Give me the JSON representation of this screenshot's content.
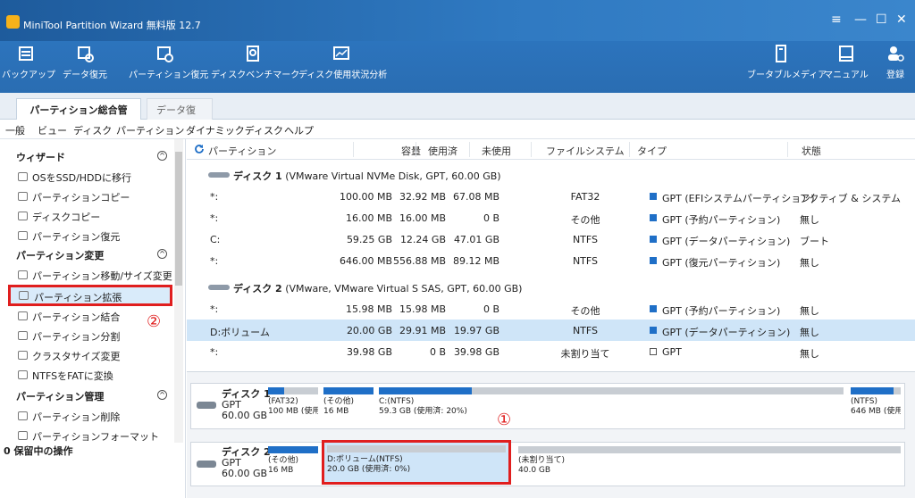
{
  "window": {
    "title": "MiniTool Partition Wizard 無料版 12.7",
    "controls": [
      "≡",
      "—",
      "☐",
      "✕"
    ]
  },
  "toolbar": {
    "items": [
      {
        "label": "バックアップ"
      },
      {
        "label": "データ復元"
      },
      {
        "label": "パーティション復元"
      },
      {
        "label": "ディスクベンチマーク"
      },
      {
        "label": "ディスク使用状況分析"
      }
    ],
    "right": [
      {
        "label": "ブータブルメディア"
      },
      {
        "label": "マニュアル"
      },
      {
        "label": "登録"
      }
    ]
  },
  "tabs": {
    "active": "パーティション総合管理",
    "inactive": "データ復元",
    "close": "✕"
  },
  "menu": [
    "一般",
    "ビュー",
    "ディスク",
    "パーティション",
    "ダイナミックディスク",
    "ヘルプ"
  ],
  "sidebar": {
    "wizard_title": "ウィザード",
    "wizard_items": [
      "OSをSSD/HDDに移行",
      "パーティションコピー",
      "ディスクコピー",
      "パーティション復元"
    ],
    "change_title": "パーティション変更",
    "change_items": [
      "パーティション移動/サイズ変更",
      "パーティション拡張",
      "パーティション結合",
      "パーティション分割",
      "クラスタサイズ変更",
      "NTFSをFATに変換"
    ],
    "manage_title": "パーティション管理",
    "manage_items": [
      "パーティション削除",
      "パーティションフォーマット"
    ],
    "pending": "0 保留中の操作",
    "marker2": "②"
  },
  "columns": [
    "パーティション",
    "容量",
    "使用済",
    "未使用",
    "ファイルシステム",
    "タイプ",
    "状態"
  ],
  "disks": [
    {
      "name": "ディスク 1",
      "detail": "(VMware Virtual NVMe Disk, GPT, 60.00 GB)",
      "rows": [
        {
          "p": "*:",
          "cap": "100.00 MB",
          "used": "32.92 MB",
          "free": "67.08 MB",
          "fs": "FAT32",
          "type": "GPT (EFIシステムパーティション)",
          "status": "アクティブ & システム"
        },
        {
          "p": "*:",
          "cap": "16.00 MB",
          "used": "16.00 MB",
          "free": "0 B",
          "fs": "その他",
          "type": "GPT (予約パーティション)",
          "status": "無し"
        },
        {
          "p": "C:",
          "cap": "59.25 GB",
          "used": "12.24 GB",
          "free": "47.01 GB",
          "fs": "NTFS",
          "type": "GPT (データパーティション)",
          "status": "ブート"
        },
        {
          "p": "*:",
          "cap": "646.00 MB",
          "used": "556.88 MB",
          "free": "89.12 MB",
          "fs": "NTFS",
          "type": "GPT (復元パーティション)",
          "status": "無し"
        }
      ]
    },
    {
      "name": "ディスク 2",
      "detail": "(VMware, VMware Virtual S SAS, GPT, 60.00 GB)",
      "rows": [
        {
          "p": "*:",
          "cap": "15.98 MB",
          "used": "15.98 MB",
          "free": "0 B",
          "fs": "その他",
          "type": "GPT (予約パーティション)",
          "status": "無し"
        },
        {
          "p": "D:ボリューム",
          "cap": "20.00 GB",
          "used": "29.91 MB",
          "free": "19.97 GB",
          "fs": "NTFS",
          "type": "GPT (データパーティション)",
          "status": "無し"
        },
        {
          "p": "*:",
          "cap": "39.98 GB",
          "used": "0 B",
          "free": "39.98 GB",
          "fs": "未割り当て",
          "type": "GPT",
          "status": "無し"
        }
      ]
    }
  ],
  "map": {
    "disk1": {
      "name": "ディスク 1",
      "type": "GPT",
      "size": "60.00 GB",
      "parts": [
        {
          "l1": "(FAT32)",
          "l2": "100 MB (使用",
          "used": 0.33
        },
        {
          "l1": "(その他)",
          "l2": "16 MB",
          "used": 1.0
        },
        {
          "l1": "C:(NTFS)",
          "l2": "59.3 GB (使用済: 20%)",
          "used": 0.2
        },
        {
          "l1": "(NTFS)",
          "l2": "646 MB (使用",
          "used": 0.86
        }
      ]
    },
    "disk2": {
      "name": "ディスク 2",
      "type": "GPT",
      "size": "60.00 GB",
      "parts": [
        {
          "l1": "(その他)",
          "l2": "16 MB",
          "used": 1.0
        },
        {
          "l1": "D:ボリューム(NTFS)",
          "l2": "20.0 GB (使用済: 0%)",
          "used": 0.0
        },
        {
          "l1": "(未割り当て)",
          "l2": "40.0 GB",
          "used": 0.0
        }
      ]
    },
    "marker1": "①"
  },
  "colors": {
    "title": "#1e5b9c",
    "toolbar": "#2a6db2",
    "highlight": "#e01e1e",
    "selected": "#cfe5f8",
    "used": "#1f6fc7"
  }
}
